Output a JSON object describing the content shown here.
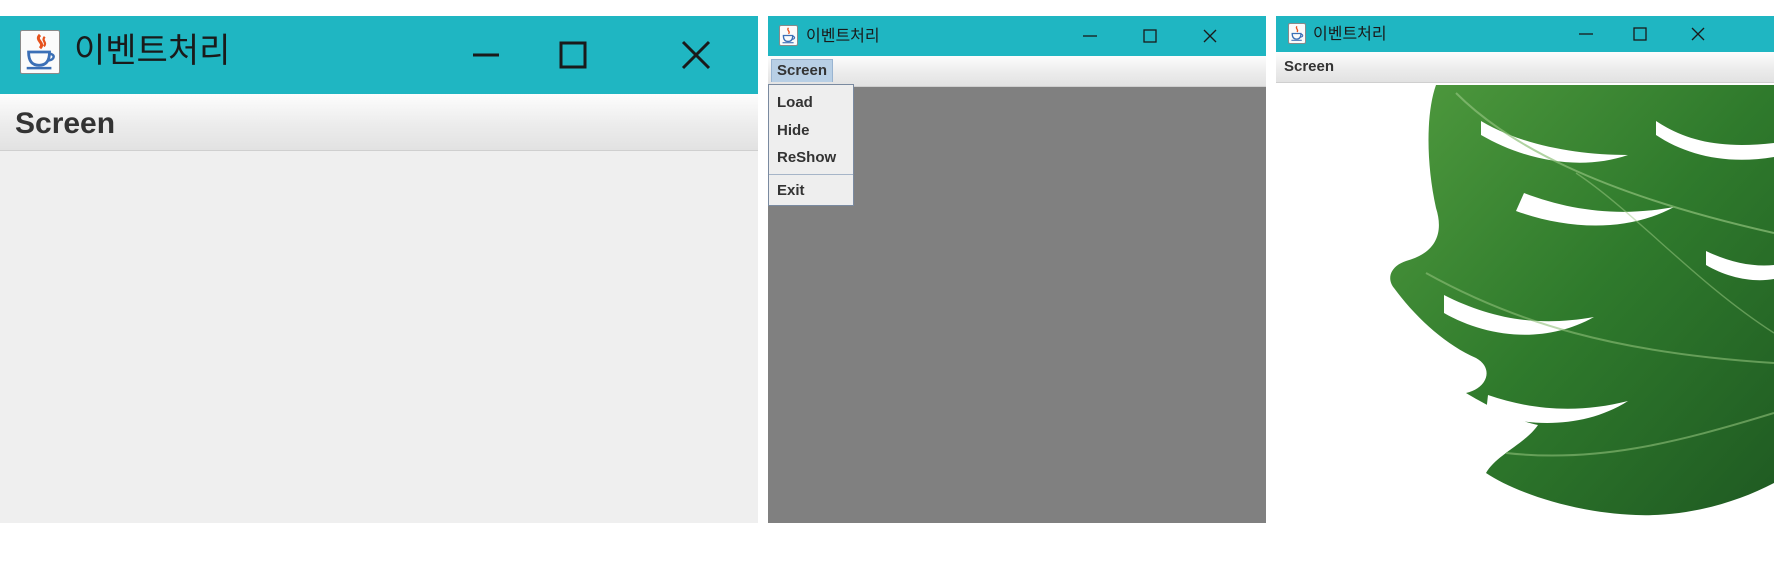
{
  "windows": [
    {
      "title": "이벤트처리",
      "menu": "Screen",
      "controls": [
        "minimize",
        "maximize",
        "close"
      ]
    },
    {
      "title": "이벤트처리",
      "menu": "Screen",
      "menu_open": true,
      "menu_items": [
        "Load",
        "Hide",
        "ReShow",
        "Exit"
      ],
      "content_color": "#808080",
      "controls": [
        "minimize",
        "maximize",
        "close"
      ]
    },
    {
      "title": "이벤트처리",
      "menu": "Screen",
      "content": "monstera-leaf-image",
      "controls": [
        "minimize",
        "maximize",
        "close"
      ]
    }
  ],
  "colors": {
    "titlebar": "#1fb6c2",
    "menu_highlight": "#b8cfe5",
    "content_gray": "#808080",
    "content_light": "#efefef",
    "leaf_green": "#2f7a2c"
  },
  "icons": [
    "java-cup-icon",
    "minimize-icon",
    "maximize-icon",
    "close-icon"
  ]
}
